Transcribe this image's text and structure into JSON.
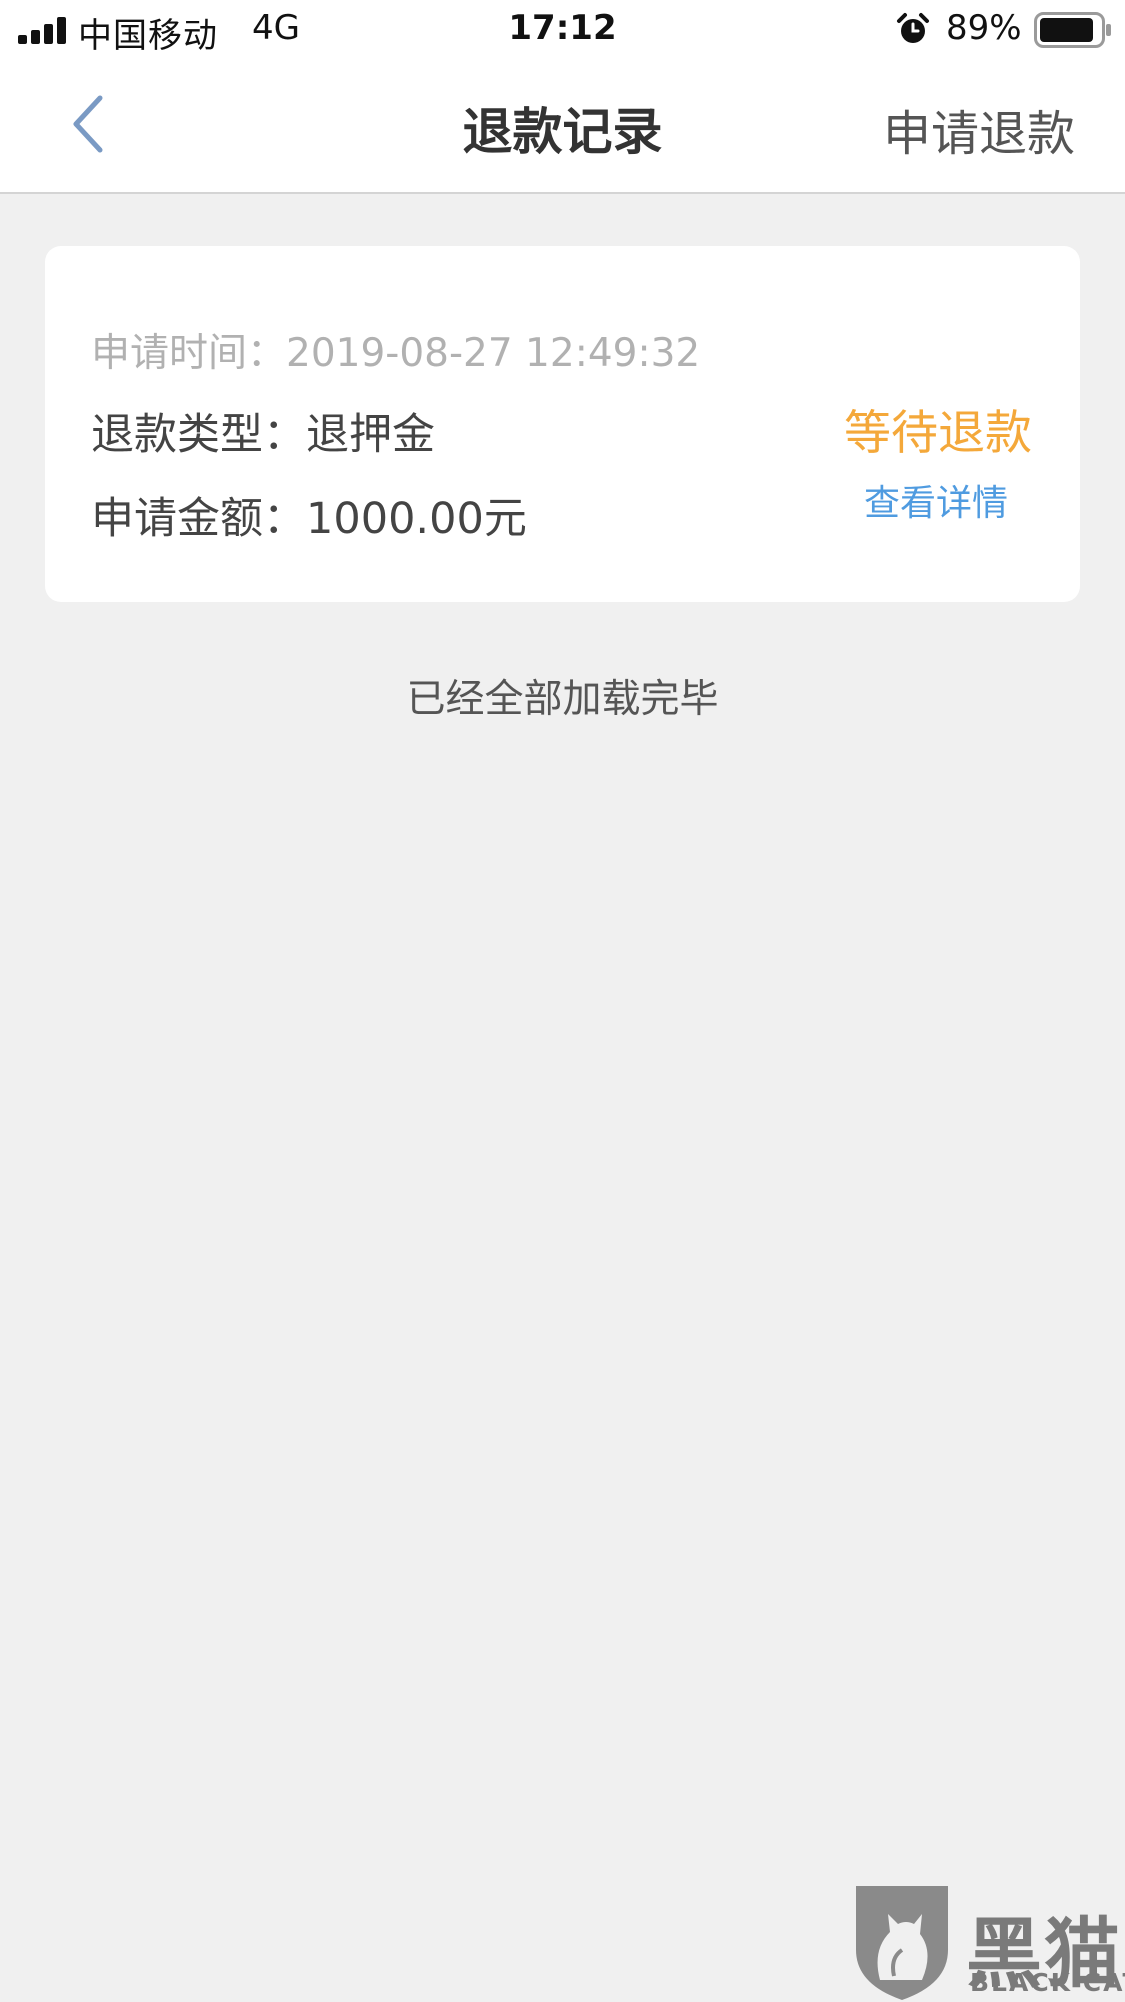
{
  "status_bar": {
    "carrier": "中国移动",
    "network": "4G",
    "time": "17:12",
    "battery": "89%",
    "battery_level": 0.89
  },
  "nav": {
    "title": "退款记录",
    "action_label": "申请退款"
  },
  "record": {
    "time_label": "申请时间：",
    "time_value": "2019-08-27 12:49:32",
    "type_label": "退款类型：",
    "type_value": "退押金",
    "amount_label": "申请金额：",
    "amount_value": "1000.00元",
    "status": "等待退款",
    "detail_link": "查看详情"
  },
  "footer": {
    "load_complete": "已经全部加载完毕"
  },
  "watermark": {
    "cn": "黑猫",
    "en": "BLACK CAT"
  },
  "colors": {
    "status_pending": "#f4a83a",
    "link": "#4f9be0",
    "background": "#f0f0f0"
  },
  "icons": {
    "back": "chevron-left-icon",
    "alarm": "alarm-clock-icon",
    "battery": "battery-icon",
    "signal": "signal-bars-icon"
  }
}
